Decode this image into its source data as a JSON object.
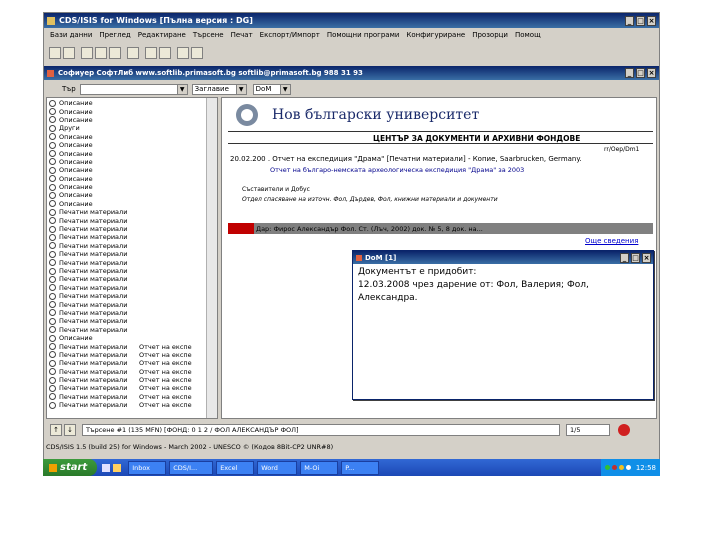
{
  "app": {
    "title": "CDS/ISIS for Windows [Пълна версия : DG]",
    "menu": [
      "Бази данни",
      "Преглед",
      "Редактиране",
      "Търсене",
      "Печат",
      "Експорт/Импорт",
      "Помощни програми",
      "Конфигуриране",
      "Прозорци",
      "Помощ"
    ]
  },
  "inner_window": {
    "title": "Софиуер   СофтЛиб www.softlib.primasoft.bg softlib@primasoft.bg 988 31 93",
    "search_label": "Тър",
    "combo1": "",
    "combo2": "Заглавие",
    "combo3": "DoM",
    "list_items": [
      {
        "a": "Описание",
        "b": ""
      },
      {
        "a": "Описание",
        "b": ""
      },
      {
        "a": "Описание",
        "b": ""
      },
      {
        "a": "Други",
        "b": ""
      },
      {
        "a": "Описание",
        "b": ""
      },
      {
        "a": "Описание",
        "b": ""
      },
      {
        "a": "Описание",
        "b": ""
      },
      {
        "a": "Описание",
        "b": ""
      },
      {
        "a": "Описание",
        "b": ""
      },
      {
        "a": "Описание",
        "b": ""
      },
      {
        "a": "Описание",
        "b": ""
      },
      {
        "a": "Описание",
        "b": ""
      },
      {
        "a": "Описание",
        "b": ""
      },
      {
        "a": "Печатни материали",
        "b": ""
      },
      {
        "a": "Печатни материали",
        "b": ""
      },
      {
        "a": "Печатни материали",
        "b": ""
      },
      {
        "a": "Печатни материали",
        "b": ""
      },
      {
        "a": "Печатни материали",
        "b": ""
      },
      {
        "a": "Печатни материали",
        "b": ""
      },
      {
        "a": "Печатни материали",
        "b": ""
      },
      {
        "a": "Печатни материали",
        "b": ""
      },
      {
        "a": "Печатни материали",
        "b": ""
      },
      {
        "a": "Печатни материали",
        "b": ""
      },
      {
        "a": "Печатни материали",
        "b": ""
      },
      {
        "a": "Печатни материали",
        "b": ""
      },
      {
        "a": "Печатни материали",
        "b": ""
      },
      {
        "a": "Печатни материали",
        "b": ""
      },
      {
        "a": "Печатни материали",
        "b": ""
      },
      {
        "a": "Описание",
        "b": ""
      },
      {
        "a": "Печатни материали",
        "b": "Отчет на експе"
      },
      {
        "a": "Печатни материали",
        "b": "Отчет на експе"
      },
      {
        "a": "Печатни материали",
        "b": "Отчет на експе"
      },
      {
        "a": "Печатни материали",
        "b": "Отчет на експе"
      },
      {
        "a": "Печатни материали",
        "b": "Отчет на експе"
      },
      {
        "a": "Печатни материали",
        "b": "Отчет на експе"
      },
      {
        "a": "Печатни материали",
        "b": "Отчет на експе"
      },
      {
        "a": "Печатни материали",
        "b": "Отчет на експе"
      }
    ],
    "doc": {
      "university": "Нов български университет",
      "center": "ЦЕНТЪР ЗА ДОКУМЕНТИ И АРХИВНИ ФОНДОВЕ",
      "ref": "rr/Oep/Dm1",
      "line1": "20.02.200 . Отчет на експедиция \"Драма\" [Печатни материали] - Копие, Saarbrucken, Germany.",
      "line2": "Отчет на българо-немската археологическа експедиция \"Драма\" за 2003",
      "line3": "Съставители и Добус",
      "line4": "Отдел спасяване на източн. Фол, Дърдев, Фол, книжни материали и документи",
      "highlight": "Дар: Фирос Александър Фол. Ст. (Лъч, 2002) док. № 5, 8 док. на... ",
      "link": "Още сведения"
    },
    "popup": {
      "title": "DoM [1]",
      "text1": "Документът е придобит:",
      "text2": "12.03.2008 чрез дарение от: Фол, Валерия; Фол,",
      "text3": "Александра."
    },
    "status": {
      "nav": "Търсене #1 (135 MFN) [ФОНД: 0 1 2 / ФОЛ АЛЕКСАНДЪР ФОЛ]",
      "page": "1/5"
    }
  },
  "bottom_status": "CDS/ISIS 1.5 (build 25) for Windows - March 2002 - UNESCO © (Кодов 8Bit-CP2 UNR#8)",
  "taskbar": {
    "start": "start",
    "tasks": [
      "Inbox",
      "CDS/I...",
      "Excel",
      "Word",
      "M-Oi",
      "P..."
    ],
    "time": "12:58"
  }
}
